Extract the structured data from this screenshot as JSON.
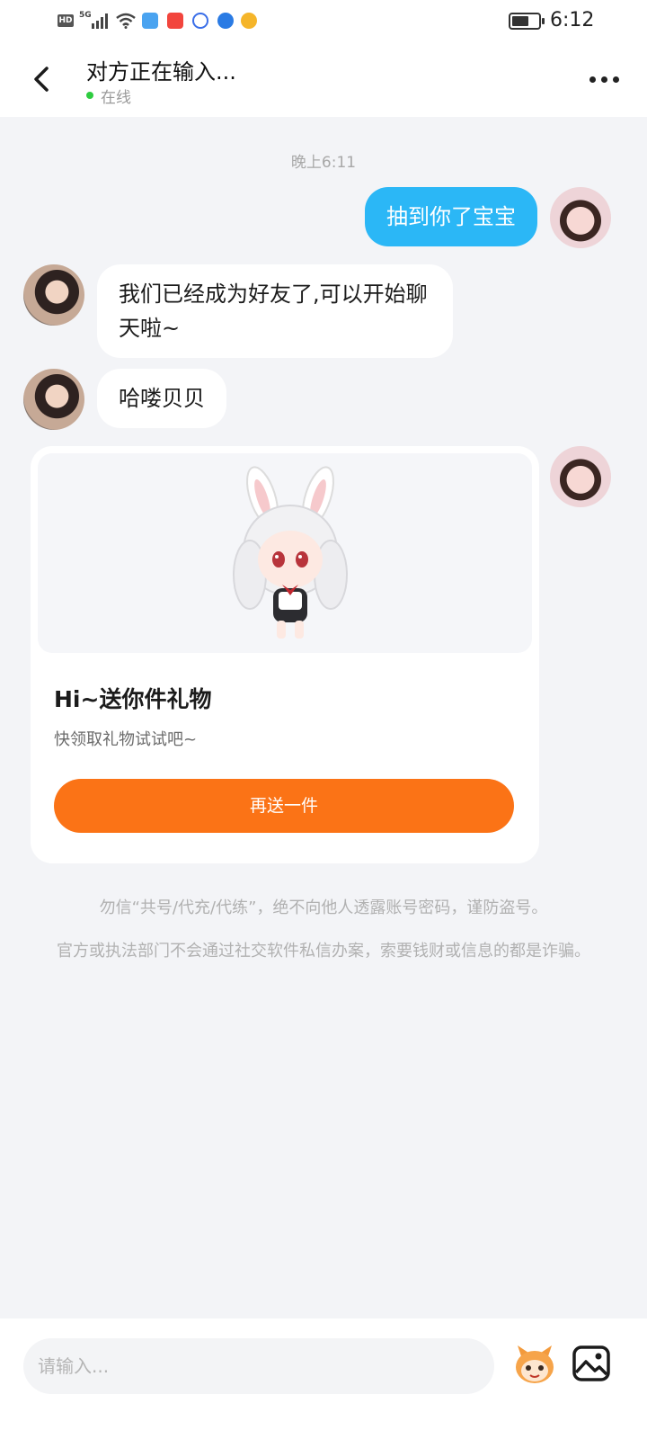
{
  "status_bar": {
    "network_badge": "HD",
    "network_type": "5G",
    "time": "6:12"
  },
  "header": {
    "title": "对方正在输入...",
    "status": "在线",
    "status_color": "#2ecc40"
  },
  "chat": {
    "timestamp": "晚上6:11",
    "messages": [
      {
        "side": "outgoing",
        "text": "抽到你了宝宝"
      },
      {
        "side": "incoming",
        "text": "我们已经成为好友了,可以开始聊天啦~"
      },
      {
        "side": "incoming",
        "text": "哈喽贝贝"
      }
    ],
    "gift_card": {
      "title": "Hi~送你件礼物",
      "subtitle": "快领取礼物试试吧~",
      "button_label": "再送一件",
      "button_color": "#fb7316"
    },
    "notices": [
      "勿信“共号/代充/代练”，绝不向他人透露账号密码，谨防盗号。",
      "官方或执法部门不会通过社交软件私信办案，索要钱财或信息的都是诈骗。"
    ]
  },
  "input_bar": {
    "placeholder": "请输入...",
    "emoji_icon": "mascot-emoji-icon",
    "image_icon": "image-icon"
  },
  "colors": {
    "outgoing_bubble": "#2bb7f6",
    "background": "#f3f4f7"
  }
}
